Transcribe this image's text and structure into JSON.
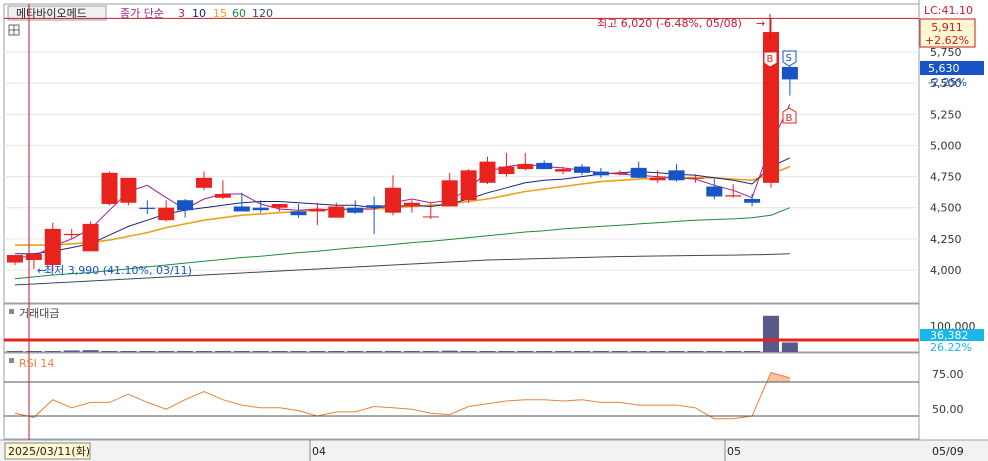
{
  "header": {
    "stock_name": "메타바이오메드",
    "ma_title": "종가 단순",
    "ma_periods": [
      "3",
      "10",
      "15",
      "60",
      "120"
    ],
    "ma_colors": [
      "#a0208c",
      "#1a237e",
      "#e8a317",
      "#1e8a3c",
      "#3a4a5a"
    ],
    "lc_label": "LC:41.10",
    "current_price_box": "5,911",
    "current_change_box": "+2.62%"
  },
  "annotations": {
    "high_label": "최고 6,020 (-6.48%, 05/08)",
    "low_label": "최저 3,990 (41.10%, 03/11)",
    "signal_s": "S",
    "signal_b": "B"
  },
  "price_axis": {
    "ticks": [
      "5,750",
      "5,500",
      "5,250",
      "5,000",
      "4,750",
      "4,500",
      "4,250",
      "4,000"
    ],
    "last_price": "5,630",
    "last_change": "-2.25%",
    "top_partial": "5,911"
  },
  "volume_panel": {
    "title": "거래대금",
    "tick": "100,000",
    "last_value": "36,382",
    "last_pct": "26.22%"
  },
  "rsi_panel": {
    "title": "RSI 14",
    "ticks": [
      "75.00",
      "50.00"
    ]
  },
  "x_axis": {
    "start_date": "2025/03/11(화)",
    "labels": [
      "04",
      "05"
    ],
    "end_label": "05/09"
  },
  "colors": {
    "up": "#e8221c",
    "down": "#1654c8",
    "grid": "#e6e6e6",
    "volume": "#5a5a8a",
    "rsi": "#e8823a",
    "highlight_line": "#c8192a",
    "last_price_bg": "#1654c8",
    "volume_value_bg": "#1ab7e6"
  },
  "chart_data": {
    "type": "candlestick",
    "dates": [
      "03/11",
      "03/12",
      "03/13",
      "03/14",
      "03/17",
      "03/18",
      "03/19",
      "03/20",
      "03/21",
      "03/24",
      "03/25",
      "03/26",
      "03/27",
      "03/28",
      "03/31",
      "04/01",
      "04/02",
      "04/03",
      "04/04",
      "04/07",
      "04/08",
      "04/09",
      "04/10",
      "04/11",
      "04/14",
      "04/15",
      "04/16",
      "04/17",
      "04/18",
      "04/21",
      "04/22",
      "04/23",
      "04/24",
      "04/25",
      "04/28",
      "04/29",
      "04/30",
      "05/02",
      "05/06",
      "05/07",
      "05/08",
      "05/09"
    ],
    "open": [
      4060,
      4080,
      4040,
      4280,
      4150,
      4530,
      4540,
      4500,
      4400,
      4560,
      4660,
      4580,
      4510,
      4500,
      4500,
      4470,
      4470,
      4420,
      4500,
      4520,
      4460,
      4510,
      4430,
      4510,
      4560,
      4700,
      4770,
      4810,
      4860,
      4790,
      4830,
      4790,
      4780,
      4820,
      4720,
      4800,
      4740,
      4670,
      4590,
      4570,
      4700,
      5630
    ],
    "high": [
      4120,
      4140,
      4380,
      4330,
      4390,
      4790,
      4560,
      4560,
      4560,
      4570,
      4790,
      4720,
      4620,
      4560,
      4530,
      4530,
      4540,
      4540,
      4560,
      4590,
      4760,
      4560,
      4540,
      4780,
      4810,
      4910,
      4940,
      4940,
      4880,
      4830,
      4850,
      4820,
      4800,
      4870,
      4800,
      4850,
      4770,
      4730,
      4690,
      4610,
      6020,
      5700
    ],
    "low": [
      4040,
      4010,
      3990,
      4250,
      4150,
      4520,
      4520,
      4450,
      4390,
      4420,
      4640,
      4570,
      4480,
      4460,
      4470,
      4420,
      4360,
      4420,
      4450,
      4290,
      4440,
      4460,
      4410,
      4510,
      4540,
      4690,
      4750,
      4800,
      4810,
      4770,
      4760,
      4740,
      4760,
      4740,
      4700,
      4710,
      4700,
      4570,
      4580,
      4510,
      4660,
      5400
    ],
    "close": [
      4120,
      4130,
      4330,
      4290,
      4370,
      4780,
      4740,
      4490,
      4500,
      4480,
      4740,
      4610,
      4470,
      4480,
      4530,
      4440,
      4490,
      4510,
      4460,
      4500,
      4660,
      4540,
      4430,
      4720,
      4800,
      4870,
      4830,
      4850,
      4810,
      4810,
      4780,
      4760,
      4780,
      4740,
      4740,
      4720,
      4740,
      4590,
      4600,
      4540,
      5910,
      5530
    ],
    "ma3": [
      4100,
      4110,
      4190,
      4250,
      4330,
      4480,
      4630,
      4680,
      4580,
      4490,
      4570,
      4610,
      4610,
      4530,
      4490,
      4480,
      4490,
      4480,
      4490,
      4490,
      4540,
      4570,
      4540,
      4560,
      4650,
      4790,
      4830,
      4850,
      4830,
      4820,
      4800,
      4780,
      4770,
      4760,
      4750,
      4740,
      4730,
      4680,
      4640,
      4580,
      5010,
      5330
    ],
    "ma10": [
      4130,
      4130,
      4150,
      4180,
      4210,
      4280,
      4350,
      4400,
      4450,
      4480,
      4500,
      4520,
      4540,
      4550,
      4550,
      4540,
      4530,
      4520,
      4520,
      4500,
      4510,
      4520,
      4510,
      4530,
      4570,
      4620,
      4660,
      4700,
      4720,
      4730,
      4750,
      4770,
      4780,
      4790,
      4780,
      4770,
      4760,
      4740,
      4720,
      4690,
      4830,
      4900
    ],
    "ma15": [
      4200,
      4200,
      4200,
      4210,
      4220,
      4240,
      4270,
      4300,
      4340,
      4370,
      4400,
      4420,
      4440,
      4450,
      4460,
      4470,
      4480,
      4490,
      4490,
      4490,
      4500,
      4510,
      4520,
      4530,
      4550,
      4570,
      4600,
      4630,
      4650,
      4670,
      4690,
      4710,
      4720,
      4730,
      4740,
      4740,
      4740,
      4740,
      4730,
      4720,
      4770,
      4830
    ],
    "ma60": [
      3930,
      3945,
      3960,
      3970,
      3980,
      3995,
      4010,
      4025,
      4040,
      4055,
      4070,
      4085,
      4100,
      4110,
      4125,
      4140,
      4150,
      4165,
      4180,
      4190,
      4205,
      4220,
      4230,
      4245,
      4260,
      4275,
      4290,
      4305,
      4315,
      4330,
      4340,
      4350,
      4360,
      4370,
      4380,
      4390,
      4400,
      4405,
      4410,
      4420,
      4440,
      4500
    ],
    "ma120": [
      3880,
      3888,
      3896,
      3904,
      3912,
      3920,
      3928,
      3936,
      3944,
      3952,
      3960,
      3968,
      3976,
      3984,
      3992,
      4000,
      4008,
      4016,
      4024,
      4032,
      4040,
      4048,
      4056,
      4064,
      4072,
      4080,
      4084,
      4088,
      4092,
      4096,
      4100,
      4104,
      4108,
      4110,
      4112,
      4114,
      4116,
      4118,
      4120,
      4122,
      4125,
      4130
    ],
    "volume": [
      1500,
      1800,
      2500,
      6000,
      7000,
      2500,
      2000,
      1800,
      1500,
      1500,
      1800,
      1500,
      1200,
      1500,
      1200,
      1200,
      1500,
      1500,
      1200,
      1500,
      1800,
      1500,
      1500,
      5000,
      2500,
      2000,
      1800,
      2500,
      2000,
      1500,
      1500,
      1500,
      1800,
      1500,
      1500,
      1500,
      1200,
      1500,
      1200,
      1200,
      138000,
      36382
    ],
    "rsi": [
      52,
      49,
      62,
      56,
      60,
      60,
      66,
      60,
      55,
      62,
      68,
      62,
      58,
      56,
      56,
      54,
      50,
      53,
      53,
      57,
      56,
      55,
      52,
      51,
      57,
      59,
      61,
      62,
      62,
      61,
      62,
      60,
      60,
      58,
      58,
      58,
      56,
      48,
      48,
      50,
      82,
      78
    ],
    "ylim": [
      3900,
      6020
    ],
    "rsi_ylim": [
      30,
      90
    ],
    "volume_max": 160000
  }
}
